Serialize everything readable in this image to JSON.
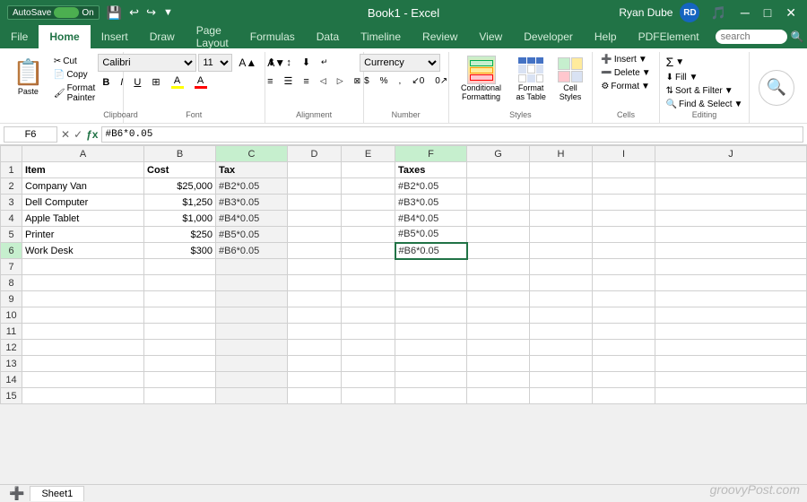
{
  "titlebar": {
    "autosave_label": "AutoSave",
    "autosave_state": "On",
    "filename": "Book1 - Excel",
    "user_name": "Ryan Dube",
    "user_initials": "RD"
  },
  "tabs": [
    "File",
    "Home",
    "Insert",
    "Draw",
    "Page Layout",
    "Formulas",
    "Data",
    "Timeline",
    "Review",
    "View",
    "Developer",
    "Help",
    "PDFElement"
  ],
  "active_tab": "Home",
  "ribbon": {
    "clipboard_group": "Clipboard",
    "font_group": "Font",
    "alignment_group": "Alignment",
    "number_group": "Number",
    "styles_group": "Styles",
    "cells_group": "Cells",
    "editing_group": "Editing",
    "paste_label": "Paste",
    "cut_label": "Cut",
    "copy_label": "Copy",
    "format_painter_label": "Format Painter",
    "font_family": "Calibri",
    "font_size": "11",
    "bold_label": "B",
    "italic_label": "I",
    "underline_label": "U",
    "number_format": "Currency",
    "conditional_format_label": "Conditional Formatting",
    "format_as_table_label": "Format as Table",
    "cell_styles_label": "Cell Styles",
    "insert_label": "Insert",
    "delete_label": "Delete",
    "format_label": "Format",
    "sum_label": "∑",
    "sort_label": "Sort & Filter",
    "find_label": "Find & Select",
    "search_placeholder": "search"
  },
  "formula_bar": {
    "name_box": "F6",
    "formula": "#B6*0.05"
  },
  "grid": {
    "col_headers": [
      "",
      "A",
      "B",
      "C",
      "D",
      "E",
      "F",
      "G",
      "H",
      "I",
      "J"
    ],
    "rows": [
      {
        "num": 1,
        "A": "Item",
        "B": "Cost",
        "C": "Tax",
        "D": "",
        "E": "",
        "F": "Taxes",
        "G": "",
        "H": "",
        "I": "",
        "J": ""
      },
      {
        "num": 2,
        "A": "Company Van",
        "B": "$25,000",
        "C": "#B2*0.05",
        "D": "",
        "E": "",
        "F": "#B2*0.05",
        "G": "",
        "H": "",
        "I": "",
        "J": ""
      },
      {
        "num": 3,
        "A": "Dell Computer",
        "B": "$1,250",
        "C": "#B3*0.05",
        "D": "",
        "E": "",
        "F": "#B3*0.05",
        "G": "",
        "H": "",
        "I": "",
        "J": ""
      },
      {
        "num": 4,
        "A": "Apple Tablet",
        "B": "$1,000",
        "C": "#B4*0.05",
        "D": "",
        "E": "",
        "F": "#B4*0.05",
        "G": "",
        "H": "",
        "I": "",
        "J": ""
      },
      {
        "num": 5,
        "A": "Printer",
        "B": "$250",
        "C": "#B5*0.05",
        "D": "",
        "E": "",
        "F": "#B5*0.05",
        "G": "",
        "H": "",
        "I": "",
        "J": ""
      },
      {
        "num": 6,
        "A": "Work Desk",
        "B": "$300",
        "C": "#B6*0.05",
        "D": "",
        "E": "",
        "F": "#B6*0.05",
        "G": "",
        "H": "",
        "I": "",
        "J": ""
      },
      {
        "num": 7,
        "A": "",
        "B": "",
        "C": "",
        "D": "",
        "E": "",
        "F": "",
        "G": "",
        "H": "",
        "I": "",
        "J": ""
      },
      {
        "num": 8,
        "A": "",
        "B": "",
        "C": "",
        "D": "",
        "E": "",
        "F": "",
        "G": "",
        "H": "",
        "I": "",
        "J": ""
      },
      {
        "num": 9,
        "A": "",
        "B": "",
        "C": "",
        "D": "",
        "E": "",
        "F": "",
        "G": "",
        "H": "",
        "I": "",
        "J": ""
      },
      {
        "num": 10,
        "A": "",
        "B": "",
        "C": "",
        "D": "",
        "E": "",
        "F": "",
        "G": "",
        "H": "",
        "I": "",
        "J": ""
      },
      {
        "num": 11,
        "A": "",
        "B": "",
        "C": "",
        "D": "",
        "E": "",
        "F": "",
        "G": "",
        "H": "",
        "I": "",
        "J": ""
      },
      {
        "num": 12,
        "A": "",
        "B": "",
        "C": "",
        "D": "",
        "E": "",
        "F": "",
        "G": "",
        "H": "",
        "I": "",
        "J": ""
      },
      {
        "num": 13,
        "A": "",
        "B": "",
        "C": "",
        "D": "",
        "E": "",
        "F": "",
        "G": "",
        "H": "",
        "I": "",
        "J": ""
      },
      {
        "num": 14,
        "A": "",
        "B": "",
        "C": "",
        "D": "",
        "E": "",
        "F": "",
        "G": "",
        "H": "",
        "I": "",
        "J": ""
      },
      {
        "num": 15,
        "A": "",
        "B": "",
        "C": "",
        "D": "",
        "E": "",
        "F": "",
        "G": "",
        "H": "",
        "I": "",
        "J": ""
      }
    ]
  },
  "watermark": "groovyPost.com",
  "sheet_tab": "Sheet1"
}
